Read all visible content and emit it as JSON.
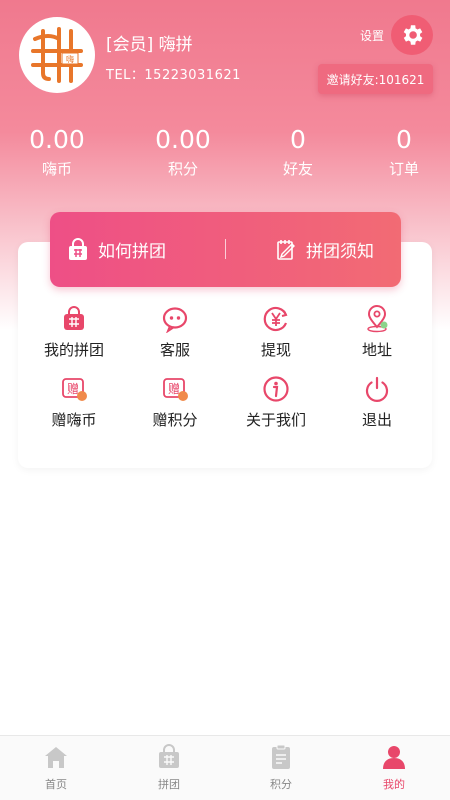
{
  "profile": {
    "member_line": "[会员] 嗨拼",
    "tel_line": "TEL：15223031621",
    "avatar_text": "嗨"
  },
  "settings": {
    "label": "设置"
  },
  "invite": {
    "label": "邀请好友:101621"
  },
  "stats": [
    {
      "value": "0.00",
      "label": "嗨币"
    },
    {
      "value": "0.00",
      "label": "积分"
    },
    {
      "value": "0",
      "label": "好友"
    },
    {
      "value": "0",
      "label": "订单"
    }
  ],
  "banner": {
    "left_label": "如何拼团",
    "right_label": "拼团须知"
  },
  "menu": [
    {
      "label": "我的拼团",
      "icon": "pin-bag-icon"
    },
    {
      "label": "客服",
      "icon": "chat-bubble-icon"
    },
    {
      "label": "提现",
      "icon": "yen-icon"
    },
    {
      "label": "地址",
      "icon": "location-icon"
    },
    {
      "label": "赠嗨币",
      "icon": "gift-coin-icon"
    },
    {
      "label": "赠积分",
      "icon": "gift-points-icon"
    },
    {
      "label": "关于我们",
      "icon": "info-icon"
    },
    {
      "label": "退出",
      "icon": "power-icon"
    }
  ],
  "nav": [
    {
      "label": "首页",
      "icon": "home-icon"
    },
    {
      "label": "拼团",
      "icon": "pin-bag-icon"
    },
    {
      "label": "积分",
      "icon": "clipboard-icon"
    },
    {
      "label": "我的",
      "icon": "user-icon"
    }
  ],
  "colors": {
    "accent": "#e8476a",
    "header_top": "#f0798e",
    "banner_start": "#ee4f86",
    "banner_end": "#f26b74",
    "nav_inactive": "#c8c8c8"
  }
}
